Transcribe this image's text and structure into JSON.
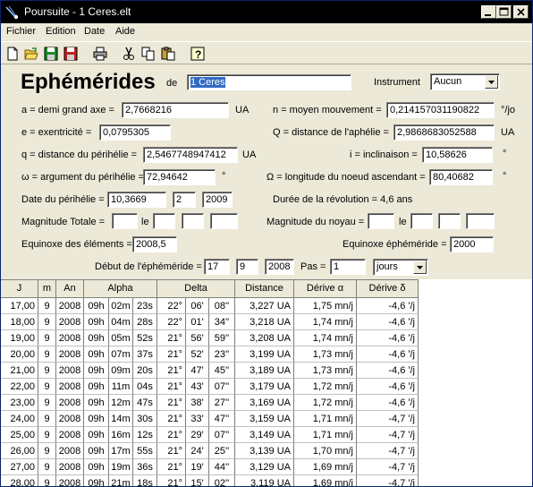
{
  "window": {
    "title": "Poursuite - 1 Ceres.elt"
  },
  "menu": [
    "Fichier",
    "Edition",
    "Date",
    "Aide"
  ],
  "toolbar_icons": [
    "new-file-icon",
    "open-folder-icon",
    "save-icon",
    "save-as-icon",
    "print-icon",
    "cut-icon",
    "copy-icon",
    "paste-icon",
    "help-icon"
  ],
  "form": {
    "title": "Ephémérides",
    "de_label": "de",
    "object_name": "1 Ceres",
    "instrument_label": "Instrument",
    "instrument_value": "Aucun",
    "a_label": "a = demi grand axe =",
    "a_value": "2,7668216",
    "a_unit": "UA",
    "n_label": "n = moyen mouvement =",
    "n_value": "0,214157031190822",
    "n_unit": "°/jo",
    "e_label": "e = exentricité =",
    "e_value": "0,0795305",
    "Q_label": "Q = distance de l'aphélie =",
    "Q_value": "2,9868683052588",
    "Q_unit": "UA",
    "q_label": "q = distance du périhélie =",
    "q_value": "2,5467748947412",
    "q_unit": "UA",
    "i_label": "i = inclinaison =",
    "i_value": "10,58626",
    "i_unit": "°",
    "w_label": "ω = argument du périhélie =",
    "w_value": "72,94642",
    "w_unit": "°",
    "omega_label": "Ω = longitude du noeud ascendant =",
    "omega_value": "80,40682",
    "omega_unit": "°",
    "date_peri_label": "Date du périhélie =",
    "date_peri_day": "10,3669",
    "date_peri_month": "2",
    "date_peri_year": "2009",
    "duree_label": "Durée de la révolution = 4,6 ans",
    "mag_totale_label": "Magnitude Totale =",
    "mag_noyau_label": "Magnitude du noyau =",
    "le_label": "le",
    "equinoxe_elements_label": "Equinoxe des éléments =",
    "equinoxe_elements_value": "2008,5",
    "equinoxe_ephem_label": "Equinoxe éphéméride =",
    "equinoxe_ephem_value": "2000",
    "debut_label": "Début de l'éphéméride =",
    "debut_day": "17",
    "debut_month": "9",
    "debut_year": "2008",
    "pas_label": "Pas =",
    "pas_value": "1",
    "pas_unit": "jours"
  },
  "table": {
    "headers": [
      "J",
      "m",
      "An",
      "Alpha",
      "Delta",
      "Distance",
      "Dérive α",
      "Dérive δ"
    ],
    "rows": [
      [
        "17,00",
        "9",
        "2008",
        "09h",
        "02m",
        "23s",
        "22°",
        "06'",
        "08''",
        "3,227 UA",
        "1,75 mn/j",
        "-4,6 '/j"
      ],
      [
        "18,00",
        "9",
        "2008",
        "09h",
        "04m",
        "28s",
        "22°",
        "01'",
        "34''",
        "3,218 UA",
        "1,74 mn/j",
        "-4,6 '/j"
      ],
      [
        "19,00",
        "9",
        "2008",
        "09h",
        "05m",
        "52s",
        "21°",
        "56'",
        "59''",
        "3,208 UA",
        "1,74 mn/j",
        "-4,6 '/j"
      ],
      [
        "20,00",
        "9",
        "2008",
        "09h",
        "07m",
        "37s",
        "21°",
        "52'",
        "23''",
        "3,199 UA",
        "1,73 mn/j",
        "-4,6 '/j"
      ],
      [
        "21,00",
        "9",
        "2008",
        "09h",
        "09m",
        "20s",
        "21°",
        "47'",
        "45''",
        "3,189 UA",
        "1,73 mn/j",
        "-4,6 '/j"
      ],
      [
        "22,00",
        "9",
        "2008",
        "09h",
        "11m",
        "04s",
        "21°",
        "43'",
        "07''",
        "3,179 UA",
        "1,72 mn/j",
        "-4,6 '/j"
      ],
      [
        "23,00",
        "9",
        "2008",
        "09h",
        "12m",
        "47s",
        "21°",
        "38'",
        "27''",
        "3,169 UA",
        "1,72 mn/j",
        "-4,6 '/j"
      ],
      [
        "24,00",
        "9",
        "2008",
        "09h",
        "14m",
        "30s",
        "21°",
        "33'",
        "47''",
        "3,159 UA",
        "1,71 mn/j",
        "-4,7 '/j"
      ],
      [
        "25,00",
        "9",
        "2008",
        "09h",
        "16m",
        "12s",
        "21°",
        "29'",
        "07''",
        "3,149 UA",
        "1,71 mn/j",
        "-4,7 '/j"
      ],
      [
        "26,00",
        "9",
        "2008",
        "09h",
        "17m",
        "55s",
        "21°",
        "24'",
        "25''",
        "3,139 UA",
        "1,70 mn/j",
        "-4,7 '/j"
      ],
      [
        "27,00",
        "9",
        "2008",
        "09h",
        "19m",
        "36s",
        "21°",
        "19'",
        "44''",
        "3,129 UA",
        "1,69 mn/j",
        "-4,7 '/j"
      ],
      [
        "28,00",
        "9",
        "2008",
        "09h",
        "21m",
        "18s",
        "21°",
        "15'",
        "02''",
        "3,119 UA",
        "1,69 mn/j",
        "-4,7 '/j"
      ]
    ]
  },
  "colors": {
    "titlebar": "#000000",
    "selection": "#316ac5",
    "face": "#ece9d8"
  }
}
